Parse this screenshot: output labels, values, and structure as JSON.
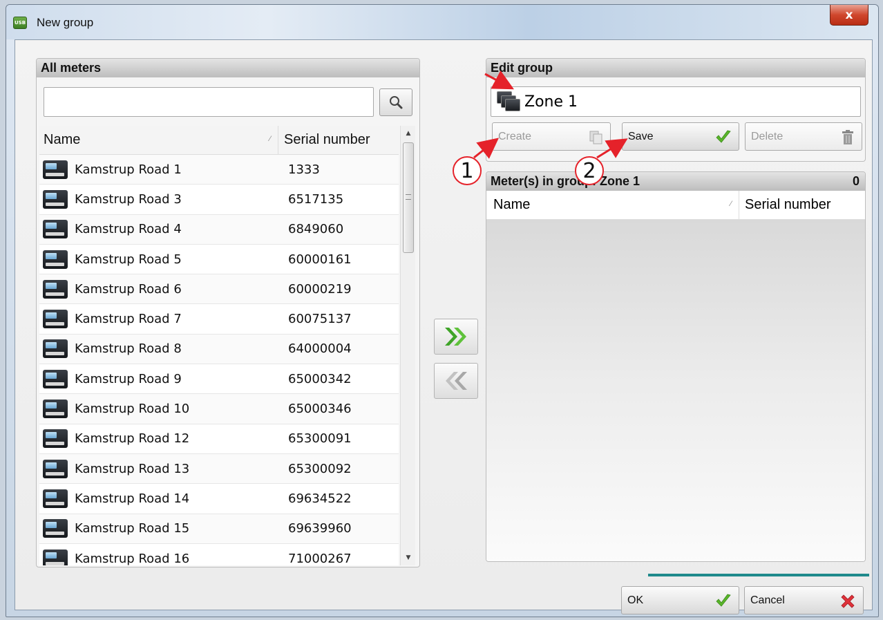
{
  "window": {
    "title": "New group",
    "app_icon_text": "USB",
    "close_label": "x"
  },
  "all_meters": {
    "title": "All meters",
    "search": {
      "value": "",
      "placeholder": ""
    },
    "columns": {
      "name": "Name",
      "serial": "Serial number"
    },
    "rows": [
      {
        "name": "Kamstrup Road 1",
        "serial": "1333"
      },
      {
        "name": "Kamstrup Road 3",
        "serial": "6517135"
      },
      {
        "name": "Kamstrup Road 4",
        "serial": "6849060"
      },
      {
        "name": "Kamstrup Road 5",
        "serial": "60000161"
      },
      {
        "name": "Kamstrup Road 6",
        "serial": "60000219"
      },
      {
        "name": "Kamstrup Road 7",
        "serial": "60075137"
      },
      {
        "name": "Kamstrup Road 8",
        "serial": "64000004"
      },
      {
        "name": "Kamstrup Road 9",
        "serial": "65000342"
      },
      {
        "name": "Kamstrup Road 10",
        "serial": "65000346"
      },
      {
        "name": "Kamstrup Road 12",
        "serial": "65300091"
      },
      {
        "name": "Kamstrup Road 13",
        "serial": "65300092"
      },
      {
        "name": "Kamstrup Road 14",
        "serial": "69634522"
      },
      {
        "name": "Kamstrup Road 15",
        "serial": "69639960"
      },
      {
        "name": "Kamstrup Road 16",
        "serial": "71000267"
      }
    ]
  },
  "edit_group": {
    "title": "Edit group",
    "group_name": "Zone 1",
    "create_label": "Create",
    "save_label": "Save",
    "delete_label": "Delete"
  },
  "meters_in_group": {
    "title": "Meter(s) in group: Zone 1",
    "count": "0",
    "columns": {
      "name": "Name",
      "serial": "Serial number"
    }
  },
  "footer": {
    "ok_label": "OK",
    "cancel_label": "Cancel"
  },
  "annotations": {
    "step1": "1",
    "step2": "2"
  },
  "colors": {
    "accent_teal": "#1f8a8c",
    "annotation_red": "#e5222a",
    "check_green": "#5ab52a",
    "cancel_red": "#e0323a"
  }
}
